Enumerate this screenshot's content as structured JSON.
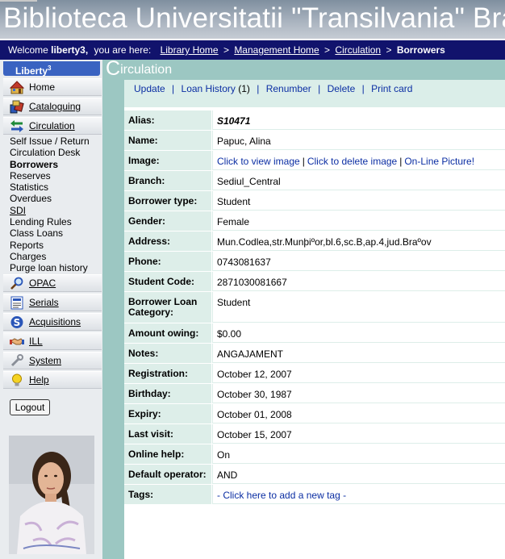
{
  "banner": {
    "title": "Biblioteca Universitatii \"Transilvania\" Bra"
  },
  "welcome": {
    "prefix": "Welcome",
    "user": "liberty3,",
    "you_are_here": "you are here:",
    "crumbs": [
      "Library Home",
      "Management Home",
      "Circulation"
    ],
    "current": "Borrowers",
    "separator": ">"
  },
  "sidebar": {
    "brand": "Liberty",
    "brand_sup": "3",
    "menu": [
      {
        "label": "Home"
      },
      {
        "label": "Cataloguing"
      },
      {
        "label": "Circulation"
      },
      {
        "label": "OPAC"
      },
      {
        "label": "Serials"
      },
      {
        "label": "Acquisitions"
      },
      {
        "label": "ILL"
      },
      {
        "label": "System"
      },
      {
        "label": "Help"
      }
    ],
    "submenu": [
      "Self Issue / Return",
      "Circulation Desk",
      "Borrowers",
      "Reserves",
      "Statistics",
      "Overdues",
      "SDI",
      "Lending Rules",
      "Class Loans",
      "Reports",
      "Charges",
      "Purge loan history"
    ],
    "logout": "Logout"
  },
  "main": {
    "section_initial": "C",
    "section_rest": "irculation",
    "actions": {
      "update": "Update",
      "loan_history": "Loan History",
      "loan_count": "(1)",
      "renumber": "Renumber",
      "delete": "Delete",
      "print_card": "Print card",
      "separator": "|"
    },
    "fields": {
      "alias": {
        "label": "Alias:",
        "value": "S10471"
      },
      "name": {
        "label": "Name:",
        "value": "Papuc, Alina"
      },
      "image": {
        "label": "Image:",
        "view": "Click to view image",
        "delete": "Click to delete image",
        "online": "On-Line Picture!"
      },
      "branch": {
        "label": "Branch:",
        "value": "Sediul_Central"
      },
      "borrower_type": {
        "label": "Borrower type:",
        "value": "Student"
      },
      "gender": {
        "label": "Gender:",
        "value": "Female"
      },
      "address": {
        "label": "Address:",
        "value": "Mun.Codlea,str.Munþiºor,bl.6,sc.B,ap.4,jud.Braºov"
      },
      "phone": {
        "label": "Phone:",
        "value": "0743081637"
      },
      "student_code": {
        "label": "Student Code:",
        "value": "2871030081667"
      },
      "loan_category": {
        "label": "Borrower Loan Category:",
        "value": "Student"
      },
      "amount_owing": {
        "label": "Amount owing:",
        "value": "$0.00"
      },
      "notes": {
        "label": "Notes:",
        "value": "ANGAJAMENT"
      },
      "registration": {
        "label": "Registration:",
        "value": "October 12, 2007"
      },
      "birthday": {
        "label": "Birthday:",
        "value": "October 30, 1987"
      },
      "expiry": {
        "label": "Expiry:",
        "value": "October 01, 2008"
      },
      "last_visit": {
        "label": "Last visit:",
        "value": "October 15, 2007"
      },
      "online_help": {
        "label": "Online help:",
        "value": "On"
      },
      "default_operator": {
        "label": "Default operator:",
        "value": "AND"
      },
      "tags": {
        "label": "Tags:",
        "value": "- Click here to add a new tag -"
      }
    }
  },
  "colors": {
    "welcome_bar": "#11136c",
    "accent_teal": "#9cc7c2",
    "label_bg": "#ddeee9",
    "link": "#0b2ea3",
    "brand_tab": "#3a63c1"
  }
}
